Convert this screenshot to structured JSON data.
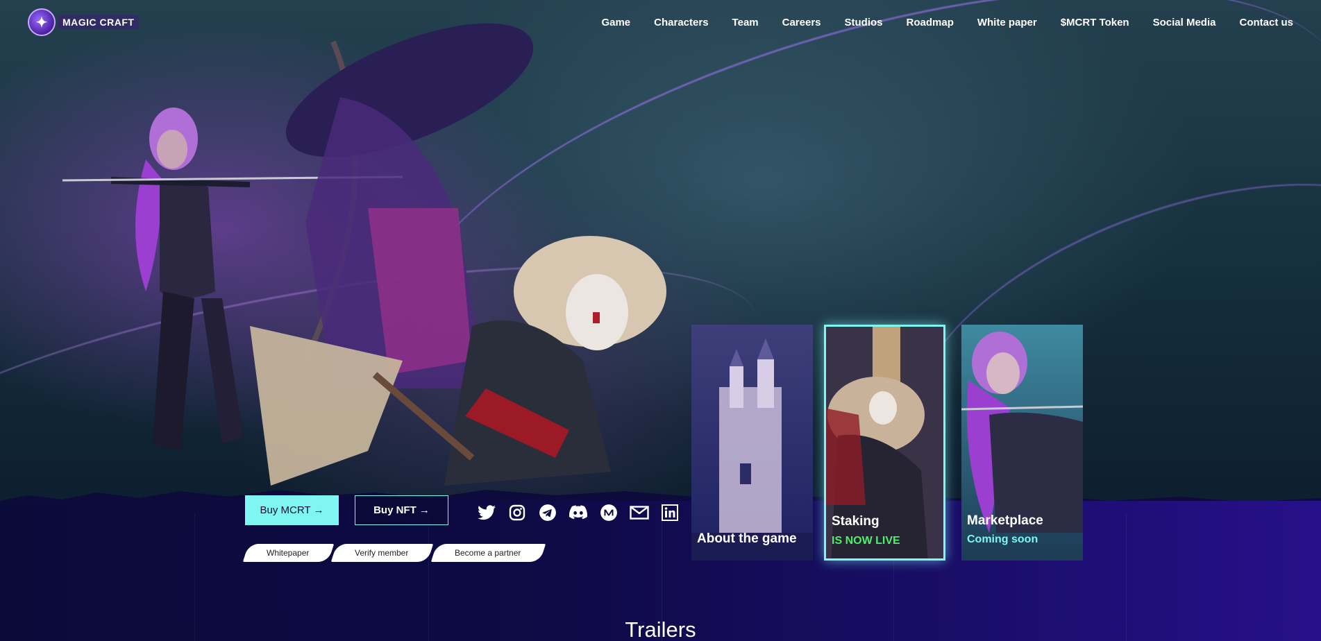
{
  "brand": {
    "logo_text": "MAGIC CRAFT"
  },
  "nav": {
    "items": [
      "Game",
      "Characters",
      "Team",
      "Careers",
      "Studios",
      "Roadmap",
      "White paper",
      "$MCRT Token",
      "Social Media",
      "Contact us"
    ]
  },
  "actions": {
    "buy_mcrt": "Buy MCRT →",
    "buy_nft": "Buy NFT →"
  },
  "socials": [
    "twitter-icon",
    "instagram-icon",
    "telegram-icon",
    "discord-icon",
    "medium-icon",
    "email-icon",
    "linkedin-icon"
  ],
  "pills": [
    "Whitepaper",
    "Verify member",
    "Become a partner"
  ],
  "cards": [
    {
      "title": "About the game",
      "subtitle": ""
    },
    {
      "title": "Staking",
      "subtitle": "IS NOW LIVE",
      "subtitle_color": "#4cf06a"
    },
    {
      "title": "Marketplace",
      "subtitle": "Coming soon",
      "subtitle_color": "#7ff6f2"
    }
  ],
  "sections": {
    "trailers_title": "Trailers"
  },
  "colors": {
    "accent": "#7ff6f2",
    "live": "#4cf06a",
    "ground": "#0d0a44"
  }
}
